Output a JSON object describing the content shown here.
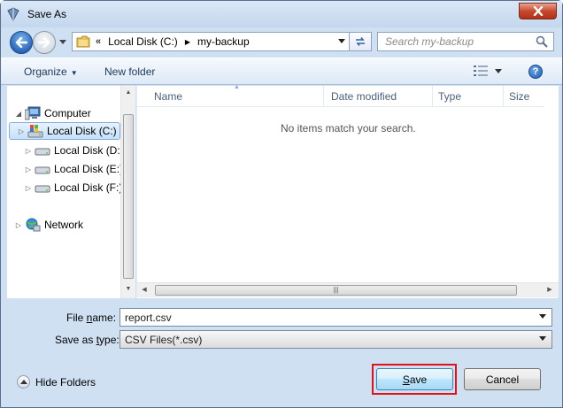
{
  "window": {
    "title": "Save As"
  },
  "navigation": {
    "breadcrumb_overflow": "«",
    "breadcrumb": [
      "Local Disk (C:)",
      "my-backup"
    ],
    "search_placeholder": "Search my-backup"
  },
  "toolbar": {
    "organize_label": "Organize",
    "new_folder_label": "New folder",
    "help_label": "?"
  },
  "nav_pane": {
    "items": [
      {
        "label": "Computer",
        "icon": "computer-icon",
        "level": 0,
        "selected": false
      },
      {
        "label": "Local Disk (C:)",
        "icon": "system-drive-icon",
        "level": 1,
        "selected": true
      },
      {
        "label": "Local Disk (D:)",
        "icon": "drive-icon",
        "level": 1,
        "selected": false
      },
      {
        "label": "Local Disk (E:)",
        "icon": "drive-icon",
        "level": 1,
        "selected": false
      },
      {
        "label": "Local Disk (F:)",
        "icon": "drive-icon",
        "level": 1,
        "selected": false
      },
      {
        "label": "Network",
        "icon": "network-icon",
        "level": 0,
        "selected": false
      }
    ]
  },
  "file_list": {
    "columns": [
      "Name",
      "Date modified",
      "Type",
      "Size"
    ],
    "empty_message": "No items match your search."
  },
  "form": {
    "file_name_label_pre": "File ",
    "file_name_label_key": "n",
    "file_name_label_post": "ame:",
    "file_name_value": "report.csv",
    "save_type_label_pre": "Save as ",
    "save_type_label_key": "t",
    "save_type_label_post": "ype:",
    "save_type_value": "CSV Files(*.csv)"
  },
  "footer": {
    "hide_folders_label": "Hide Folders",
    "save_label_key": "S",
    "save_label_rest": "ave",
    "cancel_label": "Cancel"
  },
  "colors": {
    "highlight": "#e0131a",
    "accent": "#3c7fb1"
  }
}
